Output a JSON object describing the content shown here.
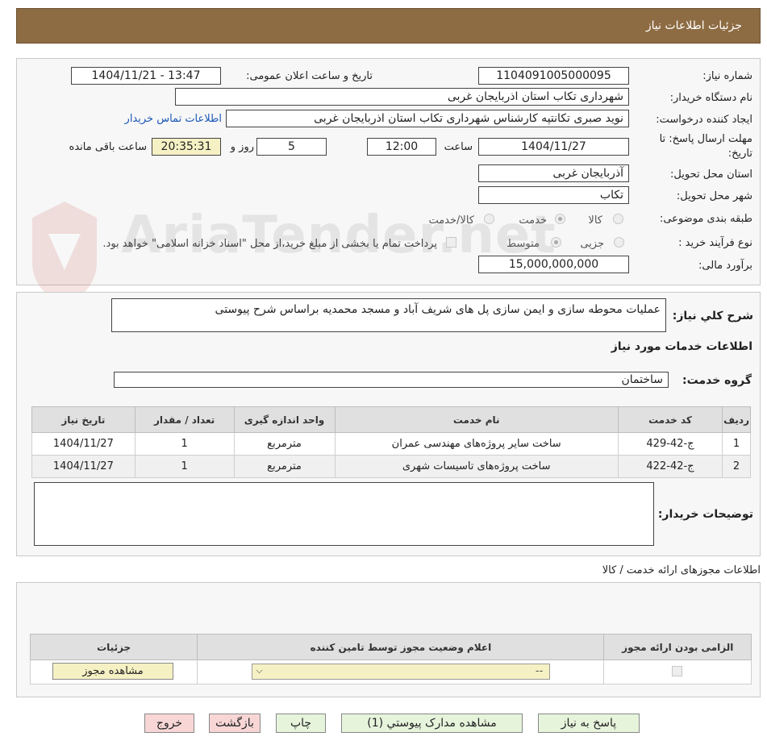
{
  "header": {
    "title": "جزئیات اطلاعات نیاز"
  },
  "watermark": {
    "text": "AriaTender.net"
  },
  "form": {
    "need_number_label": "شماره نیاز:",
    "need_number": "1104091005000095",
    "announce_label": "تاریخ و ساعت اعلان عمومی:",
    "announce_value": "1404/11/21 - 13:47",
    "buyer_org_label": "نام دستگاه خریدار:",
    "buyer_org": "شهرداری تکاب استان اذربایجان غربی",
    "creator_label": "ایجاد کننده درخواست:",
    "creator": "نوید صبری تکانتپه کارشناس شهرداری تکاب استان اذربایجان غربی",
    "contact_link": "اطلاعات تماس خریدار",
    "deadline_label_1": "مهلت ارسال پاسخ: تا",
    "deadline_label_2": "تاریخ:",
    "deadline_date": "1404/11/27",
    "time_label": "ساعت",
    "deadline_time": "12:00",
    "days_value": "5",
    "days_label": "روز و",
    "remaining_time": "20:35:31",
    "remaining_label": "ساعت باقی مانده",
    "province_label": "استان محل تحویل:",
    "province": "آذربایجان غربی",
    "city_label": "شهر محل تحویل:",
    "city": "تکاب",
    "category_label": "طبقه بندی موضوعی:",
    "category_options": [
      "کالا",
      "خدمت",
      "کالا/خدمت"
    ],
    "category_selected": "خدمت",
    "process_label": "نوع فرآیند خرید :",
    "process_options": [
      "جزیی",
      "متوسط"
    ],
    "process_selected": "متوسط",
    "payment_note": "پرداخت تمام یا بخشی از مبلغ خرید،از محل \"اسناد خزانه اسلامی\" خواهد بود.",
    "budget_label": "برآورد مالی:",
    "budget": "15,000,000,000"
  },
  "description": {
    "label": "شرح کلي نياز:",
    "text": "عملیات محوطه سازی و ایمن سازی پل های شریف آباد و مسجد محمدیه براساس شرح پیوستی"
  },
  "services": {
    "section_title": "اطلاعات خدمات مورد نياز",
    "group_label": "گروه خدمت:",
    "group_value": "ساختمان",
    "columns": [
      "رديف",
      "کد خدمت",
      "نام خدمت",
      "واحد اندازه گيری",
      "تعداد / مقدار",
      "تاريخ نياز"
    ],
    "rows": [
      {
        "row": "1",
        "code": "ج-42-429",
        "name": "ساخت سایر پروژه‌های مهندسی عمران",
        "unit": "مترمربع",
        "qty": "1",
        "date": "1404/11/27"
      },
      {
        "row": "2",
        "code": "ج-42-422",
        "name": "ساخت پروژه‌های تاسیسات شهری",
        "unit": "مترمربع",
        "qty": "1",
        "date": "1404/11/27"
      }
    ],
    "buyer_notes_label": "توضيحات خريدار:",
    "buyer_notes": ""
  },
  "permits": {
    "section_title": "اطلاعات مجوزهای ارائه خدمت / کالا",
    "columns": [
      "الزامی بودن ارائه مجوز",
      "اعلام وضعيت مجوز توسط تامين کننده",
      "جزئيات"
    ],
    "select_value": "--",
    "view_button": "مشاهده مجوز"
  },
  "buttons": {
    "reply": "پاسخ به نياز",
    "attachments": "مشاهده مدارک پيوستي (1)",
    "print": "چاپ",
    "back": "بازگشت",
    "exit": "خروج"
  }
}
